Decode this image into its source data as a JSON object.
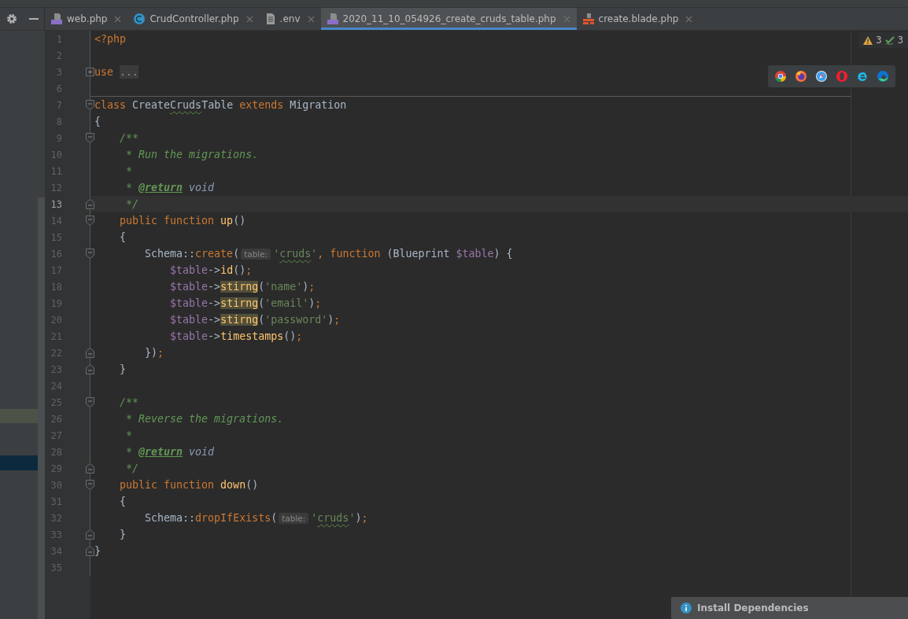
{
  "tabs": [
    {
      "label": "web.php",
      "kind": "php",
      "selected": false
    },
    {
      "label": "CrudController.php",
      "kind": "class",
      "selected": false
    },
    {
      "label": ".env",
      "kind": "file",
      "selected": false
    },
    {
      "label": "2020_11_10_054926_create_cruds_table.php",
      "kind": "php",
      "selected": true
    },
    {
      "label": "create.blade.php",
      "kind": "blade",
      "selected": false
    }
  ],
  "inspections": {
    "warnings": "3",
    "passed": "3"
  },
  "browsers": [
    {
      "kind": "chrome"
    },
    {
      "kind": "firefox"
    },
    {
      "kind": "safari"
    },
    {
      "kind": "opera"
    },
    {
      "kind": "ie"
    },
    {
      "kind": "edge"
    }
  ],
  "lines": [
    {
      "number": "1",
      "kind": "plain",
      "current": false,
      "divider": false,
      "tokens": [
        {
          "kind": "kw",
          "text": "<?php"
        }
      ]
    },
    {
      "number": "2",
      "kind": "plain",
      "current": false,
      "divider": false
    },
    {
      "number": "3",
      "kind": "collapsed",
      "current": false,
      "divider": false,
      "tokens": [
        {
          "kind": "kw",
          "text": "use "
        },
        {
          "kind": "folded",
          "text": "..."
        }
      ]
    },
    {
      "number": "6",
      "kind": "plain",
      "current": false,
      "divider": true
    },
    {
      "number": "7",
      "kind": "fold_start",
      "current": false,
      "divider": false,
      "tokens": [
        {
          "kind": "kw",
          "text": "class "
        },
        {
          "kind": "cls",
          "text": "Create"
        },
        {
          "kind": "cls-typo",
          "text": "Cruds"
        },
        {
          "kind": "cls",
          "text": "Table "
        },
        {
          "kind": "kw",
          "text": "extends "
        },
        {
          "kind": "cls",
          "text": "Migration"
        }
      ]
    },
    {
      "number": "8",
      "kind": "plain",
      "current": false,
      "divider": false,
      "tokens": [
        {
          "kind": "plain",
          "text": "{"
        }
      ]
    },
    {
      "number": "9",
      "kind": "fold_start",
      "current": false,
      "divider": false,
      "tokens": [
        {
          "kind": "comment",
          "text": "    /**"
        }
      ]
    },
    {
      "number": "10",
      "kind": "plain",
      "current": false,
      "divider": false,
      "tokens": [
        {
          "kind": "comment",
          "text": "     * Run the migrations."
        }
      ]
    },
    {
      "number": "11",
      "kind": "plain",
      "current": false,
      "divider": false,
      "tokens": [
        {
          "kind": "comment",
          "text": "     *"
        }
      ]
    },
    {
      "number": "12",
      "kind": "plain",
      "current": false,
      "divider": false,
      "tokens": [
        {
          "kind": "comment",
          "text": "     * "
        },
        {
          "kind": "doctag",
          "text": "@return"
        },
        {
          "kind": "doctype",
          "text": " void"
        }
      ]
    },
    {
      "number": "13",
      "kind": "fold_end",
      "current": true,
      "divider": false,
      "tokens": [
        {
          "kind": "comment",
          "text": "     */"
        }
      ]
    },
    {
      "number": "14",
      "kind": "fold_start",
      "current": false,
      "divider": false,
      "tokens": [
        {
          "kind": "kw",
          "text": "    public function "
        },
        {
          "kind": "fn",
          "text": "up"
        },
        {
          "kind": "plain",
          "text": "()"
        }
      ]
    },
    {
      "number": "15",
      "kind": "plain",
      "current": false,
      "divider": false,
      "tokens": [
        {
          "kind": "plain",
          "text": "    {"
        }
      ]
    },
    {
      "number": "16",
      "kind": "fold_start",
      "current": false,
      "divider": false,
      "tokens": [
        {
          "kind": "cls",
          "text": "        Schema"
        },
        {
          "kind": "plain",
          "text": "::"
        },
        {
          "kind": "kw",
          "text": "create"
        },
        {
          "kind": "plain",
          "text": "("
        },
        {
          "kind": "hint",
          "text": "table:"
        },
        {
          "kind": "str",
          "text": "'"
        },
        {
          "kind": "str-typo",
          "text": "cruds"
        },
        {
          "kind": "str",
          "text": "'"
        },
        {
          "kind": "kw",
          "text": ", function "
        },
        {
          "kind": "plain",
          "text": "("
        },
        {
          "kind": "cls",
          "text": "Blueprint "
        },
        {
          "kind": "var",
          "text": "$table"
        },
        {
          "kind": "plain",
          "text": ") {"
        }
      ]
    },
    {
      "number": "17",
      "kind": "plain",
      "current": false,
      "divider": false,
      "tokens": [
        {
          "kind": "var",
          "text": "            $table"
        },
        {
          "kind": "plain",
          "text": "->"
        },
        {
          "kind": "fn",
          "text": "id"
        },
        {
          "kind": "plain",
          "text": "()"
        },
        {
          "kind": "kw",
          "text": ";"
        }
      ]
    },
    {
      "number": "18",
      "kind": "plain",
      "current": false,
      "divider": false,
      "tokens": [
        {
          "kind": "var",
          "text": "            $table"
        },
        {
          "kind": "plain",
          "text": "->"
        },
        {
          "kind": "unknown",
          "text": "stirng"
        },
        {
          "kind": "plain",
          "text": "("
        },
        {
          "kind": "str",
          "text": "'name'"
        },
        {
          "kind": "plain",
          "text": ")"
        },
        {
          "kind": "kw",
          "text": ";"
        }
      ]
    },
    {
      "number": "19",
      "kind": "plain",
      "current": false,
      "divider": false,
      "tokens": [
        {
          "kind": "var",
          "text": "            $table"
        },
        {
          "kind": "plain",
          "text": "->"
        },
        {
          "kind": "unknown",
          "text": "stirng"
        },
        {
          "kind": "plain",
          "text": "("
        },
        {
          "kind": "str",
          "text": "'email'"
        },
        {
          "kind": "plain",
          "text": ")"
        },
        {
          "kind": "kw",
          "text": ";"
        }
      ]
    },
    {
      "number": "20",
      "kind": "plain",
      "current": false,
      "divider": false,
      "tokens": [
        {
          "kind": "var",
          "text": "            $table"
        },
        {
          "kind": "plain",
          "text": "->"
        },
        {
          "kind": "unknown",
          "text": "stirng"
        },
        {
          "kind": "plain",
          "text": "("
        },
        {
          "kind": "str",
          "text": "'password'"
        },
        {
          "kind": "plain",
          "text": ")"
        },
        {
          "kind": "kw",
          "text": ";"
        }
      ]
    },
    {
      "number": "21",
      "kind": "plain",
      "current": false,
      "divider": false,
      "tokens": [
        {
          "kind": "var",
          "text": "            $table"
        },
        {
          "kind": "plain",
          "text": "->"
        },
        {
          "kind": "fn",
          "text": "timestamps"
        },
        {
          "kind": "plain",
          "text": "()"
        },
        {
          "kind": "kw",
          "text": ";"
        }
      ]
    },
    {
      "number": "22",
      "kind": "fold_end",
      "current": false,
      "divider": false,
      "tokens": [
        {
          "kind": "plain",
          "text": "        })"
        },
        {
          "kind": "kw",
          "text": ";"
        }
      ]
    },
    {
      "number": "23",
      "kind": "fold_end",
      "current": false,
      "divider": false,
      "tokens": [
        {
          "kind": "plain",
          "text": "    }"
        }
      ]
    },
    {
      "number": "24",
      "kind": "plain",
      "current": false,
      "divider": false
    },
    {
      "number": "25",
      "kind": "fold_start",
      "current": false,
      "divider": false,
      "tokens": [
        {
          "kind": "comment",
          "text": "    /**"
        }
      ]
    },
    {
      "number": "26",
      "kind": "plain",
      "current": false,
      "divider": false,
      "tokens": [
        {
          "kind": "comment",
          "text": "     * Reverse the migrations."
        }
      ]
    },
    {
      "number": "27",
      "kind": "plain",
      "current": false,
      "divider": false,
      "tokens": [
        {
          "kind": "comment",
          "text": "     *"
        }
      ]
    },
    {
      "number": "28",
      "kind": "plain",
      "current": false,
      "divider": false,
      "tokens": [
        {
          "kind": "comment",
          "text": "     * "
        },
        {
          "kind": "doctag",
          "text": "@return"
        },
        {
          "kind": "doctype",
          "text": " void"
        }
      ]
    },
    {
      "number": "29",
      "kind": "fold_end",
      "current": false,
      "divider": false,
      "tokens": [
        {
          "kind": "comment",
          "text": "     */"
        }
      ]
    },
    {
      "number": "30",
      "kind": "fold_start",
      "current": false,
      "divider": false,
      "tokens": [
        {
          "kind": "kw",
          "text": "    public function "
        },
        {
          "kind": "fn",
          "text": "down"
        },
        {
          "kind": "plain",
          "text": "()"
        }
      ]
    },
    {
      "number": "31",
      "kind": "plain",
      "current": false,
      "divider": false,
      "tokens": [
        {
          "kind": "plain",
          "text": "    {"
        }
      ]
    },
    {
      "number": "32",
      "kind": "plain",
      "current": false,
      "divider": false,
      "tokens": [
        {
          "kind": "cls",
          "text": "        Schema"
        },
        {
          "kind": "plain",
          "text": "::"
        },
        {
          "kind": "kw",
          "text": "dropIfExists"
        },
        {
          "kind": "plain",
          "text": "("
        },
        {
          "kind": "hint",
          "text": "table:"
        },
        {
          "kind": "str",
          "text": "'"
        },
        {
          "kind": "str-typo",
          "text": "cruds"
        },
        {
          "kind": "str",
          "text": "'"
        },
        {
          "kind": "plain",
          "text": ")"
        },
        {
          "kind": "kw",
          "text": ";"
        }
      ]
    },
    {
      "number": "33",
      "kind": "fold_end",
      "current": false,
      "divider": false,
      "tokens": [
        {
          "kind": "plain",
          "text": "    }"
        }
      ]
    },
    {
      "number": "34",
      "kind": "fold_end",
      "current": false,
      "divider": false,
      "tokens": [
        {
          "kind": "plain",
          "text": "}"
        }
      ]
    },
    {
      "number": "35",
      "kind": "plain",
      "current": false,
      "divider": false
    }
  ],
  "notification": {
    "text": "Install Dependencies"
  }
}
